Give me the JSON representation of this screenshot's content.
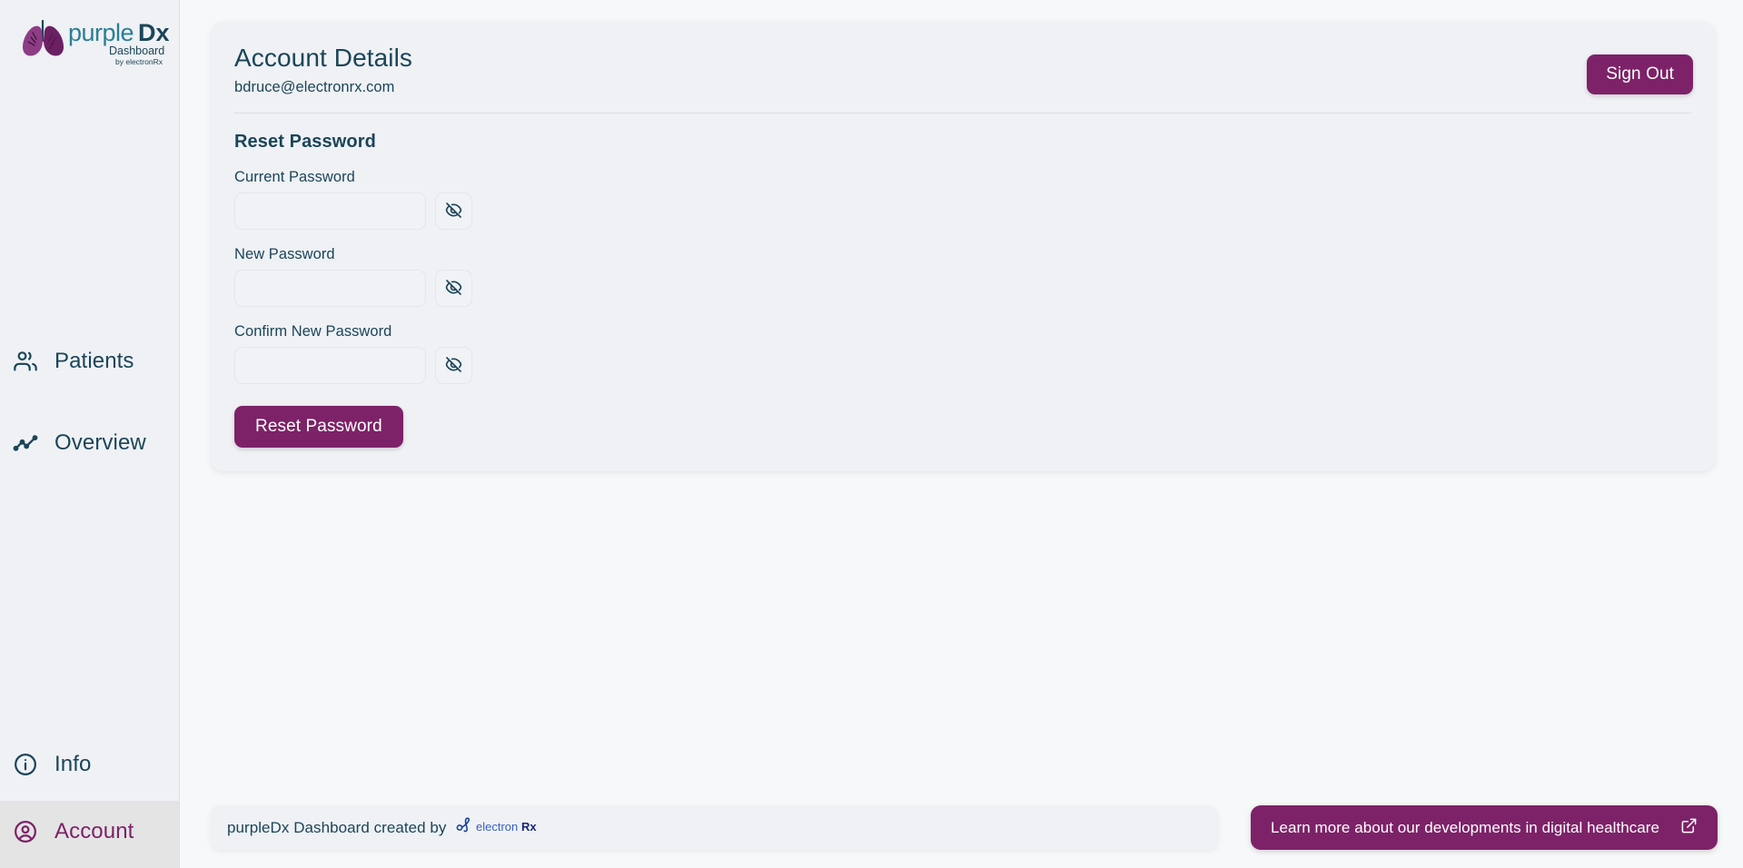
{
  "brand": {
    "name": "purpleDx",
    "subtitle": "Dashboard",
    "byline": "by electronRx",
    "logo_icon": "lungs-icon"
  },
  "colors": {
    "accent_purple": "#7D2268",
    "text_dark_teal": "#1B4558",
    "sidebar_bg": "#EFF1F5",
    "active_item_bg": "#E4E4E4",
    "page_bg": "#F7F8F9",
    "card_bg": "#EFF1F5",
    "electronrx_blue": "#1A3FA0"
  },
  "sidebar": {
    "top_items": [
      {
        "label": "Patients",
        "icon": "users-icon",
        "active": false
      },
      {
        "label": "Overview",
        "icon": "trending-line-chart-icon",
        "active": false
      }
    ],
    "bottom_items": [
      {
        "label": "Info",
        "icon": "info-circle-icon",
        "active": false
      },
      {
        "label": "Account",
        "icon": "user-circle-icon",
        "active": true
      }
    ]
  },
  "header": {
    "title": "Account Details",
    "email": "bdruce@electronrx.com",
    "sign_out_label": "Sign Out"
  },
  "reset_password": {
    "section_title": "Reset Password",
    "fields": [
      {
        "label": "Current Password",
        "value": "",
        "placeholder": "",
        "toggle_icon": "eye-off-icon"
      },
      {
        "label": "New Password",
        "value": "",
        "placeholder": "",
        "toggle_icon": "eye-off-icon"
      },
      {
        "label": "Confirm New Password",
        "value": "",
        "placeholder": "",
        "toggle_icon": "eye-off-icon"
      }
    ],
    "submit_label": "Reset Password"
  },
  "footer": {
    "credit_text": "purpleDx Dashboard created by",
    "credit_logo": "electronrx-logo",
    "learn_more_label": "Learn more about our developments in digital healthcare",
    "learn_more_icon": "external-link-icon"
  }
}
